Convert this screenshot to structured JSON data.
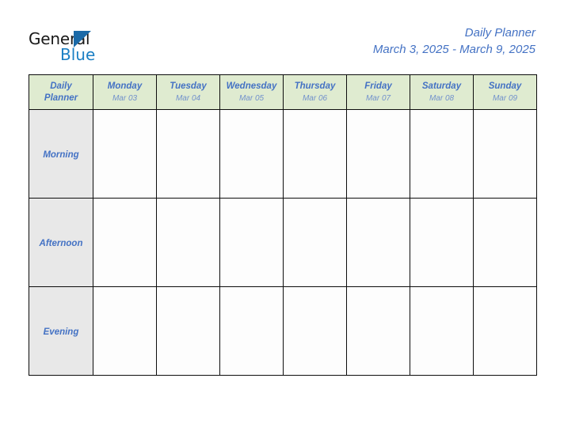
{
  "brand": {
    "word_one": "General",
    "word_two": "Blue",
    "triangle_icon": "triangle-icon",
    "color_dark": "#1a1a1a",
    "color_blue": "#1b7fc4"
  },
  "header": {
    "title": "Daily Planner",
    "date_range": "March 3, 2025 - March 9, 2025",
    "accent_color": "#4472c4"
  },
  "planner": {
    "corner": {
      "line1": "Daily",
      "line2": "Planner"
    },
    "header_bg": "#dfebd0",
    "row_label_bg": "#e8e8e8",
    "cell_bg": "#fdfdfd",
    "border_color": "#0d0d0d",
    "columns": [
      {
        "day": "Monday",
        "date": "Mar 03"
      },
      {
        "day": "Tuesday",
        "date": "Mar 04"
      },
      {
        "day": "Wednesday",
        "date": "Mar 05"
      },
      {
        "day": "Thursday",
        "date": "Mar 06"
      },
      {
        "day": "Friday",
        "date": "Mar 07"
      },
      {
        "day": "Saturday",
        "date": "Mar 08"
      },
      {
        "day": "Sunday",
        "date": "Mar 09"
      }
    ],
    "rows": [
      {
        "label": "Morning",
        "cells": [
          "",
          "",
          "",
          "",
          "",
          "",
          ""
        ]
      },
      {
        "label": "Afternoon",
        "cells": [
          "",
          "",
          "",
          "",
          "",
          "",
          ""
        ]
      },
      {
        "label": "Evening",
        "cells": [
          "",
          "",
          "",
          "",
          "",
          "",
          ""
        ]
      }
    ]
  }
}
